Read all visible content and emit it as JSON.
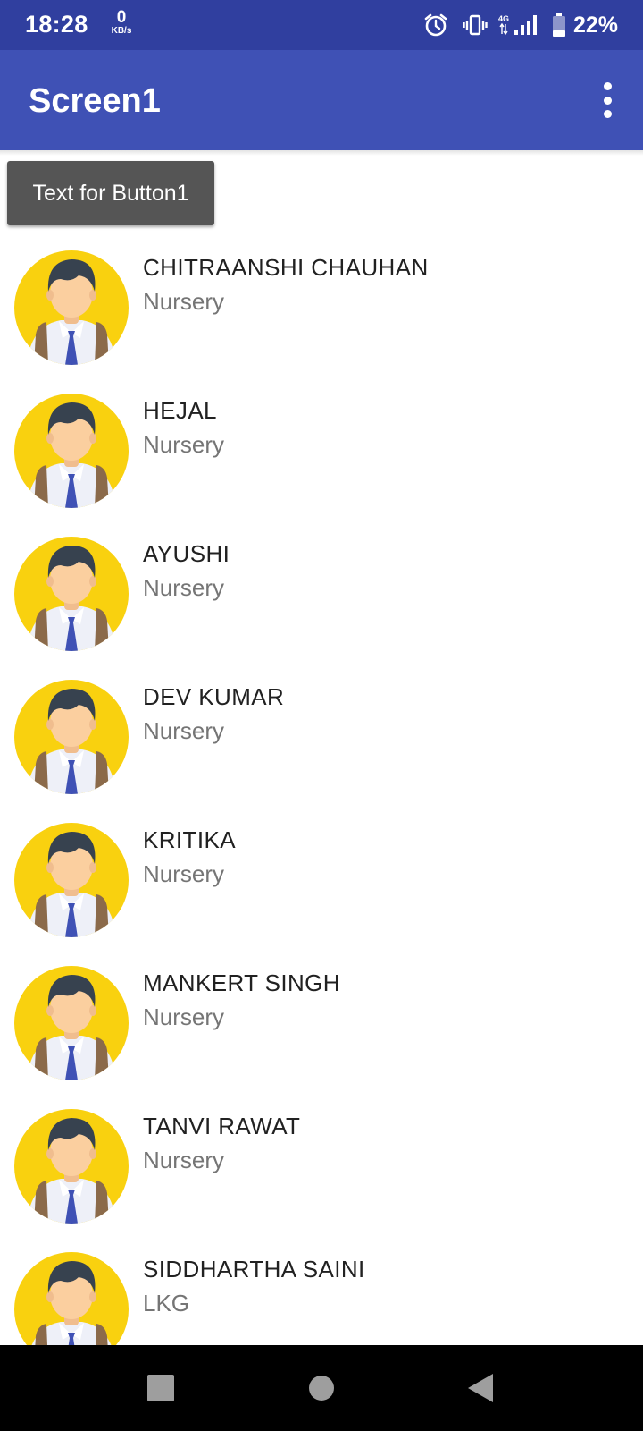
{
  "status_bar": {
    "time": "18:28",
    "net_speed_value": "0",
    "net_speed_unit": "KB/s",
    "network_type": "4G",
    "battery_percent": "22%",
    "icons": [
      "alarm-icon",
      "vibrate-icon",
      "signal-icon",
      "battery-icon"
    ]
  },
  "app_bar": {
    "title": "Screen1",
    "menu_icon": "more-vert-icon",
    "color": "#3f51b5",
    "status_color": "#303f9f"
  },
  "button1": {
    "label": "Text for Button1"
  },
  "students": [
    {
      "name": "CHITRAANSHI CHAUHAN",
      "class": "Nursery"
    },
    {
      "name": "HEJAL",
      "class": "Nursery"
    },
    {
      "name": "AYUSHI",
      "class": "Nursery"
    },
    {
      "name": "DEV KUMAR",
      "class": "Nursery"
    },
    {
      "name": "KRITIKA",
      "class": "Nursery"
    },
    {
      "name": "MANKERT SINGH",
      "class": "Nursery"
    },
    {
      "name": "TANVI RAWAT",
      "class": "Nursery"
    },
    {
      "name": "SIDDHARTHA SAINI",
      "class": "LKG"
    }
  ],
  "avatar_icon": "student-avatar-icon",
  "nav_bar": {
    "icons": [
      "recents-square-icon",
      "home-circle-icon",
      "back-triangle-icon"
    ]
  }
}
